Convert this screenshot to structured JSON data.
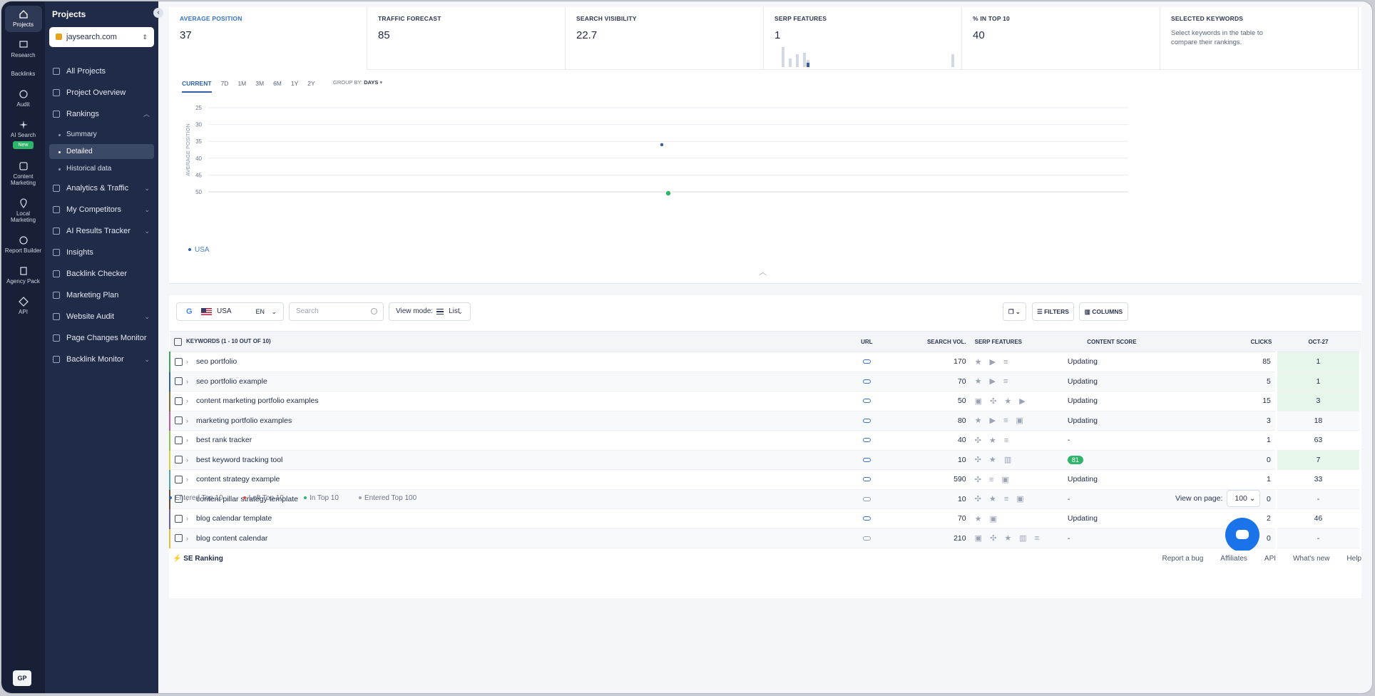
{
  "rail": {
    "items": [
      {
        "label": "Projects",
        "icon": "home-icon",
        "active": true
      },
      {
        "label": "Research",
        "icon": "research-icon"
      },
      {
        "label": "Backlinks",
        "icon": "backlinks-icon"
      },
      {
        "label": "Audit",
        "icon": "audit-icon"
      },
      {
        "label": "AI Search",
        "icon": "sparkle-icon",
        "badge": "New"
      },
      {
        "label": "Content Marketing",
        "icon": "edit-icon"
      },
      {
        "label": "Local Marketing",
        "icon": "pin-icon"
      },
      {
        "label": "Report Builder",
        "icon": "report-icon"
      },
      {
        "label": "Agency Pack",
        "icon": "building-icon"
      },
      {
        "label": "API",
        "icon": "api-icon"
      }
    ],
    "user_initials": "GP"
  },
  "nav": {
    "title": "Projects",
    "project": "jaysearch.com",
    "items": [
      "All Projects",
      "Project Overview",
      "Rankings",
      "Analytics & Traffic",
      "My Competitors",
      "AI Results Tracker",
      "Insights",
      "Backlink Checker",
      "Marketing Plan",
      "Website Audit",
      "Page Changes Monitor",
      "Backlink Monitor"
    ],
    "subitems": [
      "Summary",
      "Detailed",
      "Historical data"
    ]
  },
  "metrics": [
    {
      "label": "AVERAGE POSITION",
      "value": "37"
    },
    {
      "label": "TRAFFIC FORECAST",
      "value": "85"
    },
    {
      "label": "SEARCH VISIBILITY",
      "value": "22.7"
    },
    {
      "label": "SERP FEATURES",
      "value": "1"
    },
    {
      "label": "% IN TOP 10",
      "value": "40"
    },
    {
      "label": "SELECTED KEYWORDS",
      "desc": "Select keywords in the table to compare their rankings."
    }
  ],
  "chart": {
    "ranges": [
      "CURRENT",
      "7D",
      "1M",
      "3M",
      "6M",
      "1Y",
      "2Y"
    ],
    "group_by_label": "GROUP BY:",
    "group_by_value": "DAYS",
    "legend": "USA"
  },
  "chart_data": {
    "type": "scatter",
    "ylabel": "AVERAGE POSITION",
    "yticks": [
      25,
      30,
      35,
      40,
      45,
      50
    ],
    "ylim": [
      25,
      50
    ],
    "y_inverted": true,
    "series": [
      {
        "name": "USA",
        "color": "#2f5fa9",
        "y": [
          36
        ]
      }
    ],
    "marker_value": 50
  },
  "toolbar": {
    "engine": "G",
    "country": "USA",
    "lang": "EN",
    "search_placeholder": "Search",
    "viewmode_label": "View mode:",
    "viewmode_value": "List",
    "filters": "FILTERS",
    "columns": "COLUMNS"
  },
  "table": {
    "headers": [
      "KEYWORDS (1 - 10 OUT OF 10)",
      "URL",
      "SEARCH VOL.",
      "SERP FEATURES",
      "CONTENT SCORE",
      "CLICKS",
      "OCT-27"
    ],
    "rows": [
      {
        "keyword": "seo portfolio",
        "vol": "170",
        "serp": "★ ▶ ≡",
        "score": "Updating",
        "clicks": "85",
        "pos": "1",
        "green": true,
        "color": "#3ba45c"
      },
      {
        "keyword": "seo portfolio example",
        "vol": "70",
        "serp": "★ ▶ ≡",
        "score": "Updating",
        "clicks": "5",
        "pos": "1",
        "green": true,
        "color": "#2f5fa9"
      },
      {
        "keyword": "content marketing portfolio examples",
        "vol": "50",
        "serp": "▣ ✣ ★ ▶",
        "score": "Updating",
        "clicks": "15",
        "pos": "3",
        "green": true,
        "color": "#7b6a2c"
      },
      {
        "keyword": "marketing portfolio examples",
        "vol": "80",
        "serp": "★ ▶ ≡ ▣",
        "score": "Updating",
        "clicks": "3",
        "pos": "18",
        "green": false,
        "color": "#c45a8a"
      },
      {
        "keyword": "best rank tracker",
        "vol": "40",
        "serp": "✣ ★ ≡",
        "score": "-",
        "clicks": "1",
        "pos": "63",
        "green": false,
        "color": "#8fc64a"
      },
      {
        "keyword": "best keyword tracking tool",
        "vol": "10",
        "serp": "✣ ★ ▥",
        "score": "81",
        "clicks": "0",
        "pos": "7",
        "green": true,
        "color": "#d8d23a"
      },
      {
        "keyword": "content strategy example",
        "vol": "590",
        "serp": "✣ ≡ ▣",
        "score": "Updating",
        "clicks": "1",
        "pos": "33",
        "green": false,
        "color": "#4aa8a0"
      },
      {
        "keyword": "content pillar strategy template",
        "vol": "10",
        "serp": "✣ ★ ≡ ▣",
        "score": "-",
        "clicks": "0",
        "pos": "-",
        "green": false,
        "color": "#6b4a2a"
      },
      {
        "keyword": "blog calendar template",
        "vol": "70",
        "serp": "★ ▣",
        "score": "Updating",
        "clicks": "2",
        "pos": "46",
        "green": false,
        "color": "#6a5fb0"
      },
      {
        "keyword": "blog content calendar",
        "vol": "210",
        "serp": "▣ ✣ ★ ▥ ≡",
        "score": "-",
        "clicks": "0",
        "pos": "-",
        "green": false,
        "color": "#e0c23a"
      }
    ]
  },
  "legend": [
    {
      "label": "Entered Top 10",
      "color": "#2f5fa9"
    },
    {
      "label": "Left Top 10",
      "color": "#e04a4a"
    },
    {
      "label": "In Top 10",
      "color": "#2fb56a"
    },
    {
      "label": "Entered Top 100",
      "color": "#9aa2b3"
    }
  ],
  "viewpage": {
    "label": "View on page:",
    "value": "100"
  },
  "footer": {
    "brand": "SE Ranking",
    "links": [
      "Report a bug",
      "Affiliates",
      "API",
      "What's new",
      "Help"
    ]
  }
}
